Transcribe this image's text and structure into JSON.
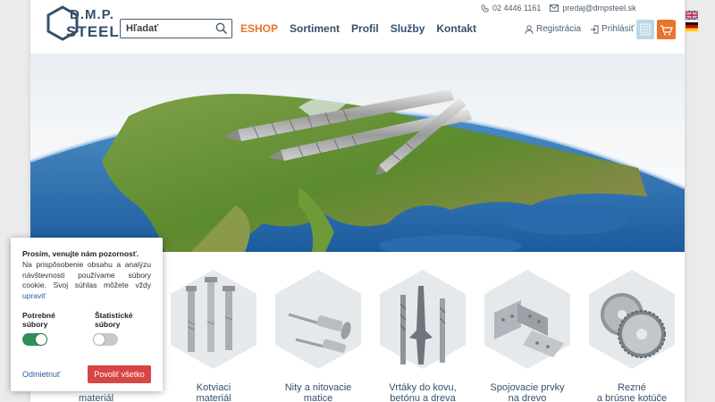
{
  "header": {
    "logo_line1": "D.M.P.",
    "logo_line2": "STEEL",
    "search_placeholder": "Hľadať",
    "nav": [
      "ESHOP",
      "Sortiment",
      "Profil",
      "Služby",
      "Kontakt"
    ],
    "phone": "02 4446 1161",
    "email": "predaj@dmpsteel.sk",
    "register": "Registrácia",
    "login": "Prihlásiť",
    "cart_count": "0",
    "accent_color": "#e8742b",
    "nav_color": "#35506b"
  },
  "categories": [
    {
      "label_line1": "Kotviaci",
      "label_line2": "materiál",
      "icon": "anchor-bolts-icon"
    },
    {
      "label_line1": "Nity a nitovacie",
      "label_line2": "matice",
      "icon": "rivet-icon"
    },
    {
      "label_line1": "Vrtáky do kovu,",
      "label_line2": "betónu a dreva",
      "icon": "drill-bits-icon"
    },
    {
      "label_line1": "Spojovacie prvky",
      "label_line2": "na drevo",
      "icon": "wood-connector-icon"
    },
    {
      "label_line1": "Rezné",
      "label_line2": "a brúsne kotúče",
      "icon": "cutting-disc-icon"
    }
  ],
  "partial_category_label": "materiál",
  "cookie": {
    "title": "Prosím, venujte nám pozornosť.",
    "text": "Na prispôsobenie obsahu a analýzu návštevnosti používame súbory cookie. Svoj súhlas môžete vždy",
    "link": "upraviť",
    "required_label": "Potrebné súbory",
    "required_enabled": true,
    "stats_label": "Štatistické súbory",
    "stats_enabled": false,
    "decline_label": "Odmietnuť",
    "accept_label": "Povoliť všetko",
    "toggle_on_color": "#2f8f57",
    "accept_color": "#d84545"
  },
  "languages": [
    "en-flag-icon",
    "de-flag-icon"
  ]
}
